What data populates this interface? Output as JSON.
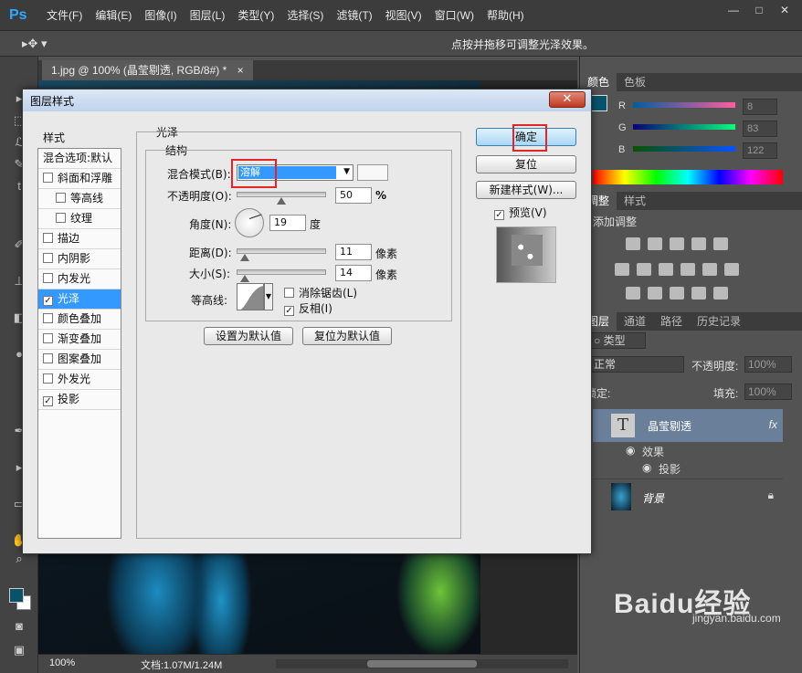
{
  "app": {
    "logo": "Ps"
  },
  "menu": [
    "文件(F)",
    "编辑(E)",
    "图像(I)",
    "图层(L)",
    "类型(Y)",
    "选择(S)",
    "滤镜(T)",
    "视图(V)",
    "窗口(W)",
    "帮助(H)"
  ],
  "window_controls": [
    "—",
    "□",
    "✕"
  ],
  "options_bar": {
    "hint": "点按并拖移可调整光泽效果。"
  },
  "document": {
    "tab_title": "1.jpg @ 100% (晶莹剔透, RGB/8#) *",
    "tab_close": "×",
    "zoom": "100%",
    "doc_size": "文档:1.07M/1.24M"
  },
  "color_panel": {
    "tabs": [
      "颜色",
      "色板"
    ],
    "channels": [
      {
        "letter": "R",
        "value": "8"
      },
      {
        "letter": "G",
        "value": "83"
      },
      {
        "letter": "B",
        "value": "122"
      }
    ],
    "fg_color": "#08536a"
  },
  "adjust_panel": {
    "tabs": [
      "调整",
      "样式"
    ],
    "title": "添加调整"
  },
  "layers_panel": {
    "tabs": [
      "图层",
      "通道",
      "路径",
      "历史记录"
    ],
    "filter_label": "类型",
    "blend_mode": "正常",
    "opacity_label": "不透明度:",
    "opacity_value": "100%",
    "lock_label": "锁定:",
    "fill_label": "填充:",
    "fill_value": "100%",
    "layers": [
      {
        "name": "晶莹剔透",
        "thumb": "T",
        "fx": "fx"
      },
      {
        "name": "效果"
      },
      {
        "name": "投影"
      },
      {
        "name": "背景"
      }
    ]
  },
  "dialog": {
    "title": "图层样式",
    "close": "✕",
    "styles_header": "样式",
    "styles": [
      {
        "label": "混合选项:默认",
        "checkbox": false,
        "checked": false,
        "indent": false
      },
      {
        "label": "斜面和浮雕",
        "checkbox": true,
        "checked": false,
        "indent": false
      },
      {
        "label": "等高线",
        "checkbox": true,
        "checked": false,
        "indent": true
      },
      {
        "label": "纹理",
        "checkbox": true,
        "checked": false,
        "indent": true
      },
      {
        "label": "描边",
        "checkbox": true,
        "checked": false,
        "indent": false
      },
      {
        "label": "内阴影",
        "checkbox": true,
        "checked": false,
        "indent": false
      },
      {
        "label": "内发光",
        "checkbox": true,
        "checked": false,
        "indent": false
      },
      {
        "label": "光泽",
        "checkbox": true,
        "checked": true,
        "indent": false,
        "selected": true
      },
      {
        "label": "颜色叠加",
        "checkbox": true,
        "checked": false,
        "indent": false
      },
      {
        "label": "渐变叠加",
        "checkbox": true,
        "checked": false,
        "indent": false
      },
      {
        "label": "图案叠加",
        "checkbox": true,
        "checked": false,
        "indent": false
      },
      {
        "label": "外发光",
        "checkbox": true,
        "checked": false,
        "indent": false
      },
      {
        "label": "投影",
        "checkbox": true,
        "checked": true,
        "indent": false
      }
    ],
    "gloss_title": "光泽",
    "structure_title": "结构",
    "blend_mode_label": "混合模式(B):",
    "blend_mode_value": "溶解",
    "opacity_label": "不透明度(O):",
    "opacity_value": "50",
    "opacity_unit": "%",
    "angle_label": "角度(N):",
    "angle_value": "19",
    "angle_unit": "度",
    "distance_label": "距离(D):",
    "distance_value": "11",
    "distance_unit": "像素",
    "size_label": "大小(S):",
    "size_value": "14",
    "size_unit": "像素",
    "contour_label": "等高线:",
    "antialias_label": "消除锯齿(L)",
    "antialias_checked": false,
    "invert_label": "反相(I)",
    "invert_checked": true,
    "set_default": "设置为默认值",
    "reset_default": "复位为默认值",
    "ok": "确定",
    "reset": "复位",
    "new_style": "新建样式(W)...",
    "preview_label": "预览(V)",
    "preview_checked": true
  },
  "watermark": {
    "brand": "Baidu经验",
    "sub": "jingyan.baidu.com"
  },
  "colors": {
    "highlight_red": "#e0262a",
    "selection_blue": "#3399ff"
  }
}
